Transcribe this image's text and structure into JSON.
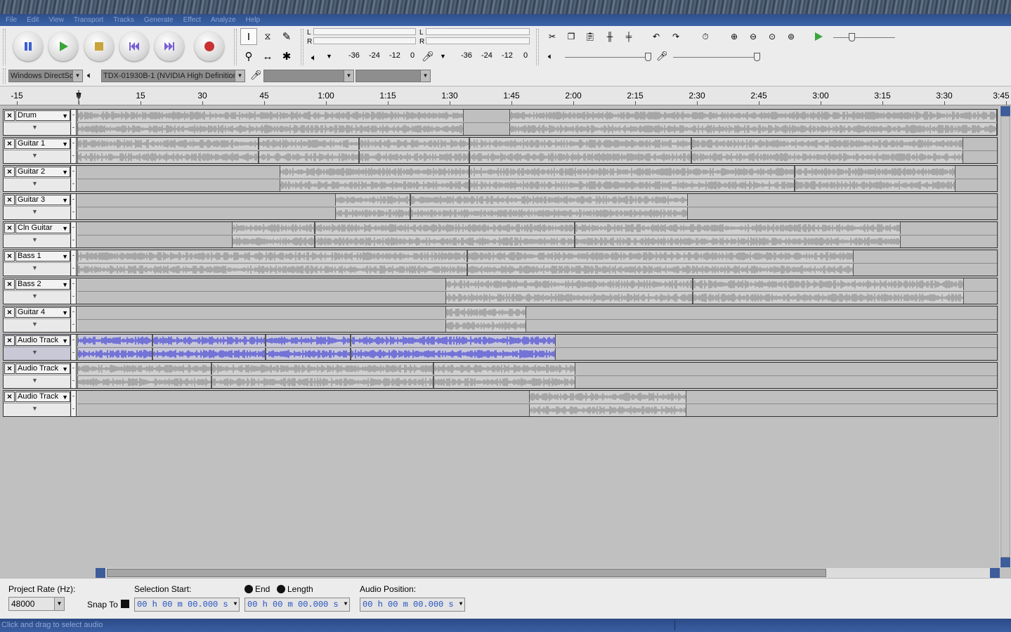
{
  "menu": [
    "File",
    "Edit",
    "View",
    "Transport",
    "Tracks",
    "Generate",
    "Effect",
    "Analyze",
    "Help"
  ],
  "meters": {
    "left": "L",
    "right": "R",
    "play_scale": [
      "-36",
      "-24",
      "-12",
      "0"
    ],
    "rec_scale": [
      "-36",
      "-24",
      "-12",
      "0"
    ]
  },
  "devices": {
    "host": "Windows DirectSo",
    "output": "TDX-01930B-1 (NVIDIA High Definition",
    "input": "",
    "channels": ""
  },
  "ruler": {
    "labels": [
      "-15",
      "0",
      "15",
      "30",
      "45",
      "1:00",
      "1:15",
      "1:30",
      "1:45",
      "2:00",
      "2:15",
      "2:30",
      "2:45",
      "3:00",
      "3:15",
      "3:30",
      "3:45"
    ]
  },
  "tracks": [
    {
      "name": "Drum",
      "selected": false,
      "clips": [
        [
          0.0,
          0.42
        ],
        [
          0.47,
          1.0
        ]
      ]
    },
    {
      "name": "Guitar 1",
      "selected": false,
      "clips": [
        [
          0.0,
          0.197
        ],
        [
          0.197,
          0.306
        ],
        [
          0.306,
          0.426
        ],
        [
          0.426,
          0.668
        ],
        [
          0.668,
          0.963
        ]
      ]
    },
    {
      "name": "Guitar 2",
      "selected": false,
      "clips": [
        [
          0.22,
          0.426
        ],
        [
          0.426,
          0.78
        ],
        [
          0.78,
          0.955
        ]
      ]
    },
    {
      "name": "Guitar 3",
      "selected": false,
      "clips": [
        [
          0.28,
          0.362
        ],
        [
          0.362,
          0.664
        ]
      ]
    },
    {
      "name": "Cln Guitar",
      "selected": false,
      "clips": [
        [
          0.168,
          0.258
        ],
        [
          0.258,
          0.541
        ],
        [
          0.541,
          0.895
        ]
      ]
    },
    {
      "name": "Bass 1",
      "selected": false,
      "clips": [
        [
          0.0,
          0.424
        ],
        [
          0.424,
          0.844
        ]
      ]
    },
    {
      "name": "Bass 2",
      "selected": false,
      "clips": [
        [
          0.4,
          0.669
        ],
        [
          0.669,
          0.964
        ]
      ]
    },
    {
      "name": "Guitar 4",
      "selected": false,
      "clips": [
        [
          0.4,
          0.488
        ]
      ]
    },
    {
      "name": "Audio Track",
      "selected": true,
      "clips": [
        [
          0.0,
          0.082
        ],
        [
          0.082,
          0.205
        ],
        [
          0.205,
          0.297
        ],
        [
          0.297,
          0.52
        ]
      ]
    },
    {
      "name": "Audio Track",
      "selected": false,
      "clips": [
        [
          0.0,
          0.146
        ],
        [
          0.146,
          0.387
        ],
        [
          0.387,
          0.542
        ]
      ]
    },
    {
      "name": "Audio Track",
      "selected": false,
      "clips": [
        [
          0.491,
          0.662
        ]
      ]
    }
  ],
  "selection_bar": {
    "project_rate_label": "Project Rate (Hz):",
    "project_rate": "48000",
    "snap_label": "Snap To",
    "sel_start_label": "Selection Start:",
    "end_label": "End",
    "length_label": "Length",
    "audio_pos_label": "Audio Position:",
    "sel_start": "00 h 00 m 00.000 s",
    "sel_end": "00 h 00 m 00.000 s",
    "audio_pos": "00 h 00 m 00.000 s"
  },
  "status": "Click and drag to select audio",
  "colors": {
    "waveform": "#8c8c8c",
    "selected_waveform": "#3c3cd6",
    "status_bg": "#3a5fa3"
  }
}
